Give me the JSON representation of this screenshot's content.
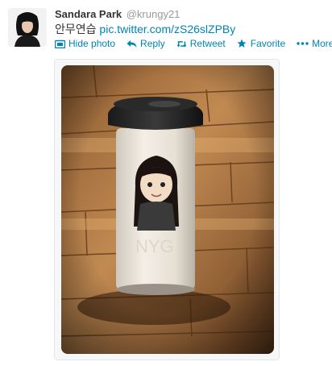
{
  "tweet": {
    "display_name": "Sandara Park",
    "handle": "@krungy21",
    "text": "안무연습",
    "link": "pic.twitter.com/zS26slZPBy"
  },
  "actions": [
    {
      "label": "Hide photo",
      "icon": "photo-icon"
    },
    {
      "label": "Reply",
      "icon": "reply-icon"
    },
    {
      "label": "Retweet",
      "icon": "retweet-icon"
    },
    {
      "label": "Favorite",
      "icon": "star-icon"
    },
    {
      "label": "More",
      "icon": "more-dots-icon"
    }
  ],
  "colors": {
    "link": "#0084b4",
    "name": "#333333",
    "handle": "#999999"
  }
}
